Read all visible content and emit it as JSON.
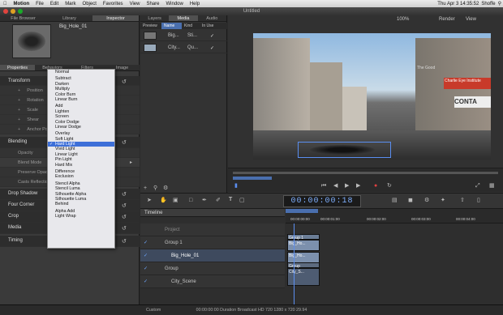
{
  "menubar": {
    "app": "Motion",
    "items": [
      "File",
      "Edit",
      "Mark",
      "Object",
      "Favorites",
      "View",
      "Share",
      "Window",
      "Help"
    ],
    "clock": "Thu Apr 3  14:35:52",
    "user": "Shoffe"
  },
  "window": {
    "title": "Untitled"
  },
  "left": {
    "tabs": [
      "File Browser",
      "Library",
      "Inspector"
    ],
    "thumb_name": "Big_Hole_01",
    "prop_tabs": [
      "Properties",
      "Behaviors",
      "Filters",
      "Image"
    ],
    "sections": {
      "transform": "Transform",
      "position": "Position",
      "rotation": "Rotation",
      "scale": "Scale",
      "shear": "Shear",
      "anchor": "Anchor Point",
      "blending": "Blending",
      "opacity": "Opacity",
      "blend_mode": "Blend Mode",
      "preserve_opacity": "Preserve Opacity",
      "casts_reflection": "Casts Reflection",
      "drop_shadow": "Drop Shadow",
      "four_corner": "Four Corner",
      "crop": "Crop",
      "media": "Media",
      "timing": "Timing"
    }
  },
  "blend_menu": {
    "groups": [
      [
        "Normal"
      ],
      [
        "Subtract",
        "Darken",
        "Multiply",
        "Color Burn",
        "Linear Burn"
      ],
      [
        "Add",
        "Lighten",
        "Screen",
        "Color Dodge",
        "Linear Dodge"
      ],
      [
        "Overlay",
        "Soft Light",
        "Hard Light",
        "Vivid Light",
        "Linear Light",
        "Pin Light",
        "Hard Mix"
      ],
      [
        "Difference",
        "Exclusion"
      ],
      [
        "Stencil Alpha",
        "Stencil Luma",
        "Silhouette Alpha",
        "Silhouette Luma",
        "Behind"
      ],
      [
        "Alpha Add",
        "Light Wrap"
      ]
    ],
    "selected": "Hard Light"
  },
  "layers": {
    "tabs": [
      "Layers",
      "Media",
      "Audio"
    ],
    "columns": [
      "Preview",
      "Name",
      "Kind",
      "In Use"
    ],
    "rows": [
      {
        "name": "Big...",
        "kind": "Sti...",
        "in_use": "✓"
      },
      {
        "name": "City...",
        "kind": "Qu...",
        "in_use": "✓"
      }
    ]
  },
  "viewer": {
    "zoom": "100%",
    "render": "Render",
    "view": "View",
    "overlay_text": "",
    "signs": [
      "The Good",
      "Charlie Eye Institute",
      "CONTA"
    ]
  },
  "transport": {
    "timecode": "00:00:00:18"
  },
  "timeline": {
    "title": "Timeline",
    "tracks": [
      {
        "name": "Project",
        "selected": false
      },
      {
        "name": "Group 1",
        "selected": false
      },
      {
        "name": "Big_Hole_01",
        "selected": true
      },
      {
        "name": "Group",
        "selected": false
      },
      {
        "name": "City_Scene",
        "selected": false
      }
    ],
    "ruler": [
      "00:00:00:00",
      "00:00:01:00",
      "00:00:02:00",
      "00:00:03:00",
      "00:00:04:00"
    ],
    "clips": [
      {
        "label": "Group 1",
        "row": 1
      },
      {
        "label": "Big_Ho...",
        "row": 2
      },
      {
        "label": "Big_Ho...",
        "row": 2
      },
      {
        "label": "Group",
        "row": 3
      },
      {
        "label": "City_S...",
        "row": 4
      }
    ]
  },
  "statusbar": {
    "left": "Custom",
    "text": "00:00:00:00  Duration Broadcast HD 720 1280 x 720 29.94"
  },
  "colors": {
    "accent": "#3d6fd8",
    "timecode": "#7fb0ff"
  }
}
